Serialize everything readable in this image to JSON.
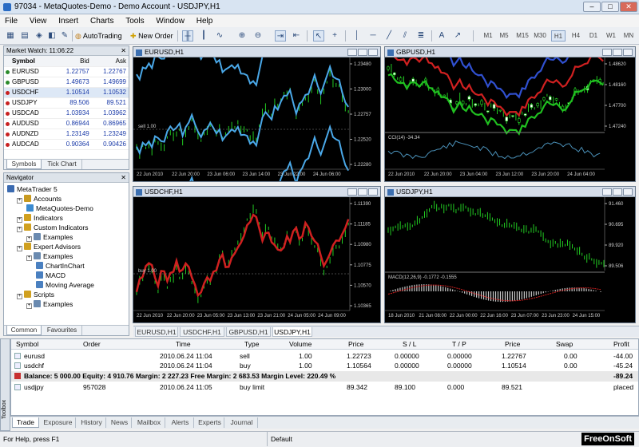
{
  "window": {
    "title": "97034 - MetaQuotes-Demo - Demo Account - USDJPY,H1"
  },
  "menu": [
    "File",
    "View",
    "Insert",
    "Charts",
    "Tools",
    "Window",
    "Help"
  ],
  "toolbar": {
    "autotrading": "AutoTrading",
    "new_order": "New Order",
    "timeframes": [
      "M1",
      "M5",
      "M15",
      "M30",
      "H1",
      "H4",
      "D1",
      "W1",
      "MN"
    ],
    "active_timeframe": "H1"
  },
  "market_watch": {
    "title": "Market Watch: 11:06:22",
    "headers": {
      "symbol": "Symbol",
      "bid": "Bid",
      "ask": "Ask"
    },
    "rows": [
      {
        "symbol": "EURUSD",
        "bid": "1.22757",
        "ask": "1.22767",
        "color": "#2a8a2a"
      },
      {
        "symbol": "GBPUSD",
        "bid": "1.49673",
        "ask": "1.49699",
        "color": "#2a8a2a"
      },
      {
        "symbol": "USDCHF",
        "bid": "1.10514",
        "ask": "1.10532",
        "color": "#c82020"
      },
      {
        "symbol": "USDJPY",
        "bid": "89.506",
        "ask": "89.521",
        "color": "#c82020"
      },
      {
        "symbol": "USDCAD",
        "bid": "1.03934",
        "ask": "1.03962",
        "color": "#c82020"
      },
      {
        "symbol": "AUDUSD",
        "bid": "0.86944",
        "ask": "0.86965",
        "color": "#c82020"
      },
      {
        "symbol": "AUDNZD",
        "bid": "1.23149",
        "ask": "1.23249",
        "color": "#c82020"
      },
      {
        "symbol": "AUDCAD",
        "bid": "0.90364",
        "ask": "0.90426",
        "color": "#c82020"
      }
    ],
    "tabs": [
      "Symbols",
      "Tick Chart"
    ]
  },
  "navigator": {
    "title": "Navigator",
    "items": [
      {
        "label": "MetaTrader 5",
        "level": 0
      },
      {
        "label": "Accounts",
        "level": 1
      },
      {
        "label": "MetaQuotes-Demo",
        "level": 2
      },
      {
        "label": "Indicators",
        "level": 1
      },
      {
        "label": "Custom Indicators",
        "level": 1
      },
      {
        "label": "Examples",
        "level": 2
      },
      {
        "label": "Expert Advisors",
        "level": 1
      },
      {
        "label": "Examples",
        "level": 2
      },
      {
        "label": "ChartInChart",
        "level": 3
      },
      {
        "label": "MACD",
        "level": 3
      },
      {
        "label": "Moving Average",
        "level": 3
      },
      {
        "label": "Scripts",
        "level": 1
      },
      {
        "label": "Examples",
        "level": 2
      }
    ],
    "tabs": [
      "Common",
      "Favourites"
    ]
  },
  "charts": {
    "eurusd": {
      "title": "EURUSD,H1",
      "prices": [
        "1.23480",
        "1.23000",
        "1.22757",
        "1.22520",
        "1.22280"
      ],
      "times": [
        "22 Jun 2010",
        "22 Jun 20:00",
        "23 Jun 06:00",
        "23 Jun 14:00",
        "23 Jun 22:00",
        "24 Jun 06:00"
      ],
      "sell_label": "sell 1.00"
    },
    "gbpusd": {
      "title": "GBPUSD,H1",
      "prices": [
        "1.48620",
        "1.48160",
        "1.47700",
        "1.47240"
      ],
      "cci_label": "CCI(14) -34.34",
      "cci_levels": [
        "242.55",
        "100.00",
        "0.00",
        "-100.00",
        "-199.25"
      ],
      "times": [
        "22 Jun 2010",
        "22 Jun 20:00",
        "23 Jun 04:00",
        "23 Jun 12:00",
        "23 Jun 20:00",
        "24 Jun 04:00"
      ]
    },
    "usdchf": {
      "title": "USDCHF,H1",
      "prices": [
        "1.11390",
        "1.11185",
        "1.10980",
        "1.10775",
        "1.10570",
        "1.10365"
      ],
      "buy_label": "buy 1.00",
      "times": [
        "22 Jun 2010",
        "22 Jun 20:00",
        "23 Jun 05:00",
        "23 Jun 13:00",
        "23 Jun 21:00",
        "24 Jun 05:00",
        "24 Jun 09:00"
      ]
    },
    "usdjpy": {
      "title": "USDJPY,H1",
      "prices": [
        "91.460",
        "90.695",
        "89.920",
        "89.506"
      ],
      "macd_label": "MACD(12,26,9) -0.1772 -0.1555",
      "macd_levels": [
        "0.1621",
        "-0.2199"
      ],
      "times": [
        "18 Jun 2010",
        "21 Jun 08:00",
        "22 Jun 00:00",
        "22 Jun 16:00",
        "23 Jun 07:00",
        "23 Jun 23:00",
        "24 Jun 15:00"
      ]
    }
  },
  "chart_tabs": [
    {
      "label": "EURUSD,H1",
      "active": false
    },
    {
      "label": "USDCHF,H1",
      "active": false
    },
    {
      "label": "GBPUSD,H1",
      "active": false
    },
    {
      "label": "USDJPY,H1",
      "active": true
    }
  ],
  "terminal": {
    "headers": [
      "Symbol",
      "Order",
      "Time",
      "Type",
      "Volume",
      "Price",
      "S / L",
      "T / P",
      "Price",
      "Swap",
      "Profit"
    ],
    "positions": [
      {
        "symbol": "eurusd",
        "order": "",
        "time": "2010.06.24 11:04",
        "type": "sell",
        "volume": "1.00",
        "price": "1.22723",
        "sl": "0.00000",
        "tp": "0.00000",
        "cur": "1.22767",
        "swap": "0.00",
        "profit": "-44.00"
      },
      {
        "symbol": "usdchf",
        "order": "",
        "time": "2010.06.24 11:04",
        "type": "buy",
        "volume": "1.00",
        "price": "1.10564",
        "sl": "0.00000",
        "tp": "0.00000",
        "cur": "1.10514",
        "swap": "0.00",
        "profit": "-45.24"
      }
    ],
    "balance_line": "Balance: 5 000.00  Equity: 4 910.76  Margin: 2 227.23  Free Margin: 2 683.53  Margin Level: 220.49 %",
    "balance_profit": "-89.24",
    "orders": [
      {
        "symbol": "usdjpy",
        "order": "957028",
        "time": "2010.06.24 11:05",
        "type": "buy limit",
        "volume": "",
        "price": "89.342",
        "sl": "89.100",
        "tp": "0.000",
        "cur": "89.521",
        "swap": "",
        "profit": "placed"
      }
    ],
    "tabs": [
      "Trade",
      "Exposure",
      "History",
      "News",
      "Mailbox",
      "Alerts",
      "Experts",
      "Journal"
    ],
    "toolbox_label": "Toolbox"
  },
  "status": {
    "help": "For Help, press F1",
    "profile": "Default",
    "logo": "FreeOnSoft"
  }
}
